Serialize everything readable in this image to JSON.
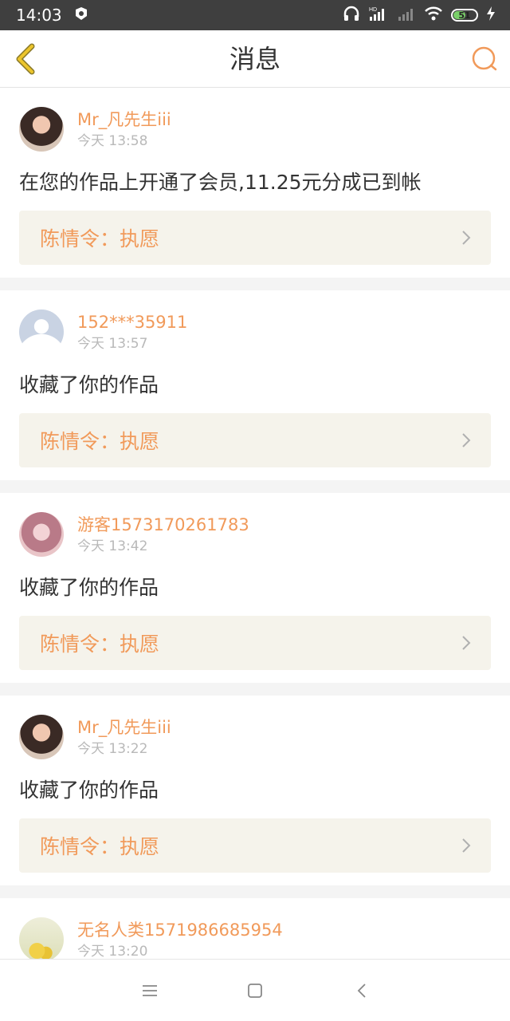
{
  "status_bar": {
    "time": "14:03",
    "battery": "51",
    "battery_level": 0.51
  },
  "header": {
    "title": "消息"
  },
  "messages": [
    {
      "name": "Mr_凡先生iii",
      "time": "今天 13:58",
      "text": "在您的作品上开通了会员,11.25元分成已到帐",
      "work": "陈情令：执愿"
    },
    {
      "name": "152***35911",
      "time": "今天 13:57",
      "text": "收藏了你的作品",
      "work": "陈情令：执愿"
    },
    {
      "name": "游客1573170261783",
      "time": "今天 13:42",
      "text": "收藏了你的作品",
      "work": "陈情令：执愿"
    },
    {
      "name": "Mr_凡先生iii",
      "time": "今天 13:22",
      "text": "收藏了你的作品",
      "work": "陈情令：执愿"
    },
    {
      "name": "无名人类1571986685954",
      "time": "今天 13:20"
    }
  ],
  "colors": {
    "accent": "#f19a5a",
    "back_icon": "#e8c02a",
    "status_bar": "#3f3f3f",
    "link_bg": "#f5f3eb"
  }
}
